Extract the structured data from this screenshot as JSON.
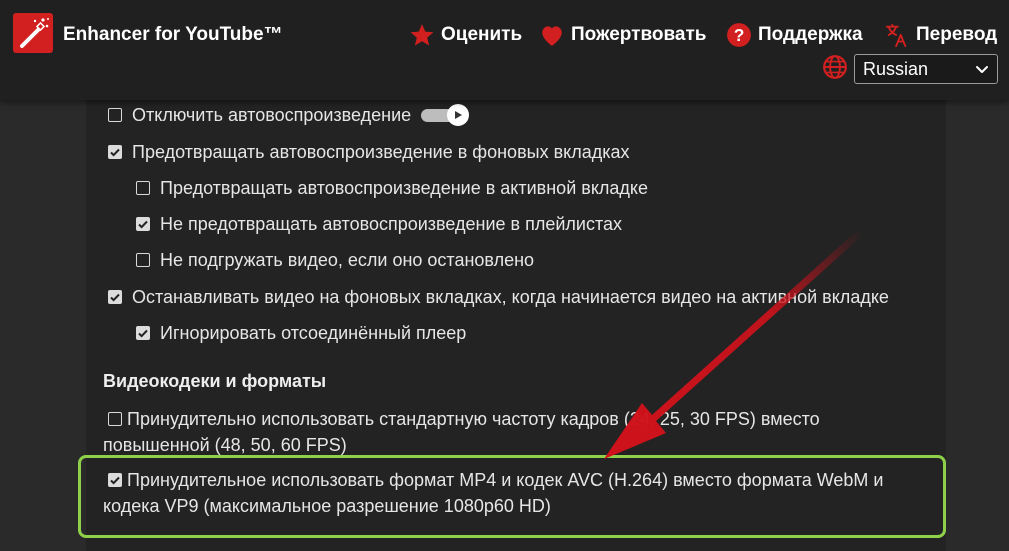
{
  "header": {
    "app_title": "Enhancer for YouTube™",
    "links": [
      {
        "label": "Оценить",
        "icon": "star-icon"
      },
      {
        "label": "Пожертвовать",
        "icon": "heart-icon"
      },
      {
        "label": "Поддержка",
        "icon": "help-icon"
      },
      {
        "label": "Перевод",
        "icon": "translate-icon"
      }
    ],
    "language": {
      "selected": "Russian",
      "icon": "globe-icon"
    }
  },
  "options": [
    {
      "label": "Отключить автовоспроизведение",
      "checked": false,
      "indent": 0
    },
    {
      "label": "Предотвращать автовоспроизведение в фоновых вкладках",
      "checked": true,
      "indent": 0
    },
    {
      "label": "Предотвращать автовоспроизведение в активной вкладке",
      "checked": false,
      "indent": 1
    },
    {
      "label": "Не предотвращать автовоспроизведение в плейлистах",
      "checked": true,
      "indent": 1
    },
    {
      "label": "Не подгружать видео, если оно остановлено",
      "checked": false,
      "indent": 1
    },
    {
      "label": "Останавливать видео на фоновых вкладках, когда начинается видео на активной вкладке",
      "checked": true,
      "indent": 0
    },
    {
      "label": "Игнорировать отсоединённый плеер",
      "checked": true,
      "indent": 1
    }
  ],
  "codec_section": {
    "title": "Видеокодеки и форматы",
    "option_fps": {
      "label": "Принудительно использовать стандартную частоту кадров (24, 25, 30 FPS) вместо повышенной (48, 50, 60 FPS)",
      "checked": false
    },
    "option_mp4": {
      "label": "Принудительное использовать формат MP4 и кодек AVC (H.264) вместо формата WebM и кодека VP9 (максимальное разрешение 1080p60 HD)",
      "checked": true
    }
  },
  "colors": {
    "accent_red": "#d21f1f",
    "highlight_green": "#8ed04a",
    "arrow_red": "#d0121b"
  }
}
